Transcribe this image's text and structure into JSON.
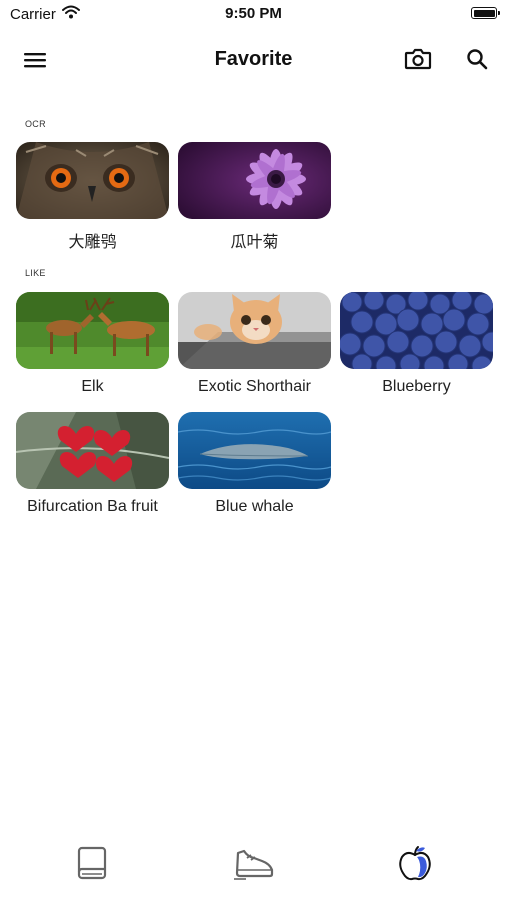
{
  "status_bar": {
    "carrier": "Carrier",
    "time": "9:50 PM"
  },
  "nav": {
    "title": "Favorite",
    "icons": [
      "menu-icon",
      "camera-icon",
      "search-icon"
    ]
  },
  "sections": {
    "ocr": {
      "label": "OCR",
      "items": [
        {
          "caption": "大雕鸮",
          "image": "owl"
        },
        {
          "caption": "瓜叶菊",
          "image": "purple-daisy"
        }
      ]
    },
    "like": {
      "label": "LIKE",
      "items": [
        {
          "caption": "Elk",
          "image": "elk"
        },
        {
          "caption": "Exotic Shorthair",
          "image": "cat"
        },
        {
          "caption": "Blueberry",
          "image": "blueberries"
        },
        {
          "caption": "Bifurcation Ba fruit",
          "image": "heart-fruit"
        },
        {
          "caption": "Blue whale",
          "image": "whale"
        }
      ]
    }
  },
  "tab_bar": {
    "tabs": [
      {
        "icon": "book-icon",
        "active": false
      },
      {
        "icon": "shoe-icon",
        "active": false
      },
      {
        "icon": "apple-icon",
        "active": true
      }
    ],
    "active_color": "#3b5bdb",
    "inactive_color": "#666666"
  }
}
